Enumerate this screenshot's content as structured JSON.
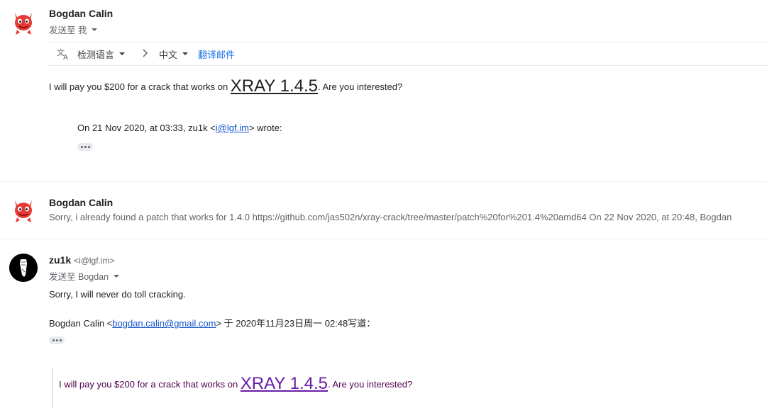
{
  "messages": [
    {
      "sender": "Bogdan Calin",
      "recipient_line": "发送至 我",
      "translate_bar": {
        "detect_language": "检测语言",
        "target_language": "中文",
        "translate_link": "翻译邮件"
      },
      "body_prefix": "I will pay you $200 for a crack that works on ",
      "body_big": "XRAY 1.4.5",
      "body_suffix": ". Are you interested?",
      "quote_header_prefix": "On 21 Nov 2020, at 03:33, zu1k <",
      "quote_header_email": "i@lgf.im",
      "quote_header_suffix": "> wrote:"
    },
    {
      "sender": "Bogdan Calin",
      "snippet": "Sorry, i already found a patch that works for 1.4.0 https://github.com/jas502n/xray-crack/tree/master/patch%20for%201.4%20amd64 On 22 Nov 2020, at 20:48, Bogdan"
    },
    {
      "sender": "zu1k",
      "email": "<i@lgf.im>",
      "recipient_line": "发送至 Bogdan",
      "body": "Sorry, I will never do toll cracking.",
      "reply_header_prefix": "Bogdan Calin <",
      "reply_header_email": "bogdan.calin@gmail.com",
      "reply_header_suffix": "> 于 2020年11月23日周一 02:48写道：",
      "quoted_prefix": "I will pay you $200 for a crack that works on ",
      "quoted_big": "XRAY 1.4.5",
      "quoted_suffix": ". Are you interested?"
    }
  ],
  "colors": {
    "avatar_red": "#e53935",
    "link_blue": "#1155cc",
    "visited_purple": "#681da8",
    "translate_blue": "#1a73e8"
  }
}
